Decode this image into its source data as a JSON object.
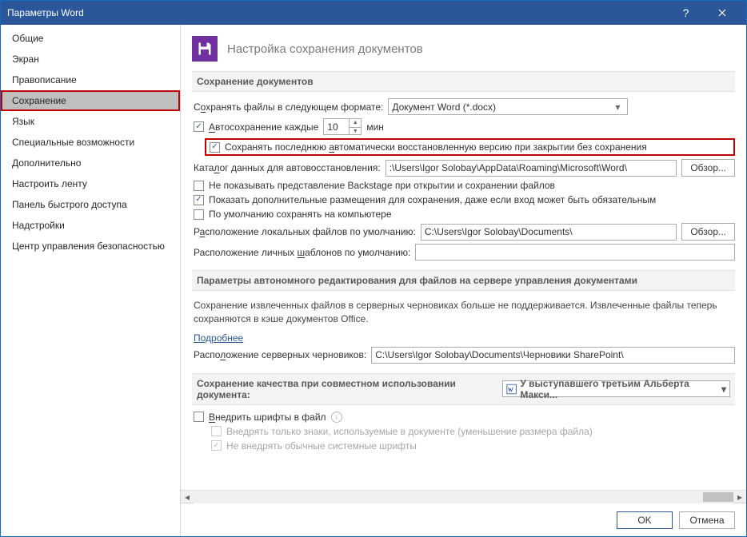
{
  "title": "Параметры Word",
  "sidebar": {
    "items": [
      {
        "label": "Общие"
      },
      {
        "label": "Экран"
      },
      {
        "label": "Правописание"
      },
      {
        "label": "Сохранение"
      },
      {
        "label": "Язык"
      },
      {
        "label": "Специальные возможности"
      },
      {
        "label": "Дополнительно"
      },
      {
        "label": "Настроить ленту"
      },
      {
        "label": "Панель быстрого доступа"
      },
      {
        "label": "Надстройки"
      },
      {
        "label": "Центр управления безопасностью"
      }
    ],
    "selected_index": 3
  },
  "header": {
    "title": "Настройка сохранения документов"
  },
  "section1": {
    "title": "Сохранение документов",
    "save_format_label_pre": "С",
    "save_format_label_u": "о",
    "save_format_label_post": "хранять файлы в следующем формате:",
    "save_format_value": "Документ Word (*.docx)",
    "autosave_u": "А",
    "autosave_post": "втосохранение каждые",
    "autosave_minutes": "10",
    "autosave_unit": "мин",
    "keep_last_pre": "Сохранять последнюю ",
    "keep_last_u": "а",
    "keep_last_post": "втоматически восстановленную версию при закрытии без сохранения",
    "autorec_label_pre": "Ката",
    "autorec_label_u": "л",
    "autorec_label_post": "ог данных для автовосстановления:",
    "autorec_path": ":\\Users\\Igor Solobay\\AppData\\Roaming\\Microsoft\\Word\\",
    "browse1": "Обзор...",
    "backstage_label": "Не показывать представление Backstage при открытии и сохранении файлов",
    "extra_loc_label": "Показать дополнительные размещения для сохранения, даже если вход может быть обязательным",
    "default_comp_label": "По умолчанию сохранять на компьютере",
    "default_loc_pre": "Р",
    "default_loc_u": "а",
    "default_loc_post": "сположение локальных файлов по умолчанию:",
    "default_loc_path": "C:\\Users\\Igor Solobay\\Documents\\",
    "browse2": "Обзор...",
    "templates_pre": "Расположение личных ",
    "templates_u": "ш",
    "templates_post": "аблонов по умолчанию:"
  },
  "section2": {
    "title": "Параметры автономного редактирования для файлов на сервере управления документами",
    "para": "Сохранение извлеченных файлов в серверных черновиках больше не поддерживается. Извлеченные файлы теперь сохраняются в кэше документов Office.",
    "link": "Подробнее",
    "drafts_pre": "Распо",
    "drafts_u": "л",
    "drafts_post": "ожение серверных черновиков:",
    "drafts_path": "C:\\Users\\Igor Solobay\\Documents\\Черновики SharePoint\\"
  },
  "section3": {
    "title": "Сохранение качества при совместном использовании документа:",
    "doc_name": "У выступавшего третьим Альберта Макси...",
    "embed_pre": "",
    "embed_u": "В",
    "embed_post": "недрить шрифты в файл",
    "only_used": "Внедрять только знаки, используемые в документе (уменьшение размера файла)",
    "no_system": "Не внедрять обычные системные шрифты"
  },
  "footer": {
    "ok": "OK",
    "cancel": "Отмена"
  }
}
